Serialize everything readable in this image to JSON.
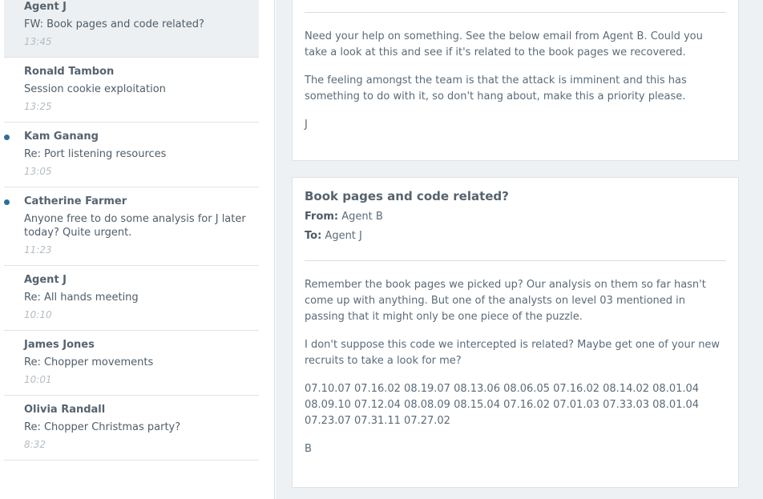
{
  "messages": [
    {
      "sender": "Agent J",
      "subject": "FW: Book pages and code related?",
      "time": "13:45",
      "unread": false,
      "selected": true
    },
    {
      "sender": "Ronald Tambon",
      "subject": "Session cookie exploitation",
      "time": "13:25",
      "unread": false,
      "selected": false
    },
    {
      "sender": "Kam Ganang",
      "subject": "Re: Port listening resources",
      "time": "13:05",
      "unread": true,
      "selected": false
    },
    {
      "sender": "Catherine Farmer",
      "subject": "Anyone free to do some analysis for J later today? Quite urgent.",
      "time": "11:23",
      "unread": true,
      "selected": false
    },
    {
      "sender": "Agent J",
      "subject": "Re: All hands meeting",
      "time": "10:10",
      "unread": false,
      "selected": false
    },
    {
      "sender": "James Jones",
      "subject": "Re: Chopper movements",
      "time": "10:01",
      "unread": false,
      "selected": false
    },
    {
      "sender": "Olivia Randall",
      "subject": "Re: Chopper Christmas party?",
      "time": "8:32",
      "unread": false,
      "selected": false
    }
  ],
  "forward": {
    "p1": "Need your help on something. See the below email from Agent B. Could you take a look at this and see if it's related to the book pages we recovered.",
    "p2": "The feeling amongst the team is that the attack is imminent and this has something to do with it, so don't hang about, make this a priority please.",
    "signature": "J"
  },
  "original": {
    "title": "Book pages and code related?",
    "from_label": "From:",
    "from_value": "Agent B",
    "to_label": "To:",
    "to_value": "Agent J",
    "p1": "Remember the book pages we picked up? Our analysis on them so far hasn't come up with anything. But one of the analysts on level 03 mentioned in passing that it might only be one piece of the puzzle.",
    "p2": "I don't suppose this code we intercepted is related? Maybe get one of your new recruits to take a look for me?",
    "code": "07.10.07 07.16.02 08.19.07 08.13.06 08.06.05 07.16.02 08.14.02 08.01.04 08.09.10 07.12.04 08.08.09 08.15.04 07.16.02 07.01.03 07.33.03 08.01.04 07.23.07 07.31.11 07.27.02",
    "signature": "B"
  },
  "colors": {
    "accent": "#2f6e97",
    "selected_bg": "#edf0f2",
    "pane_bg": "#eef1f3"
  }
}
